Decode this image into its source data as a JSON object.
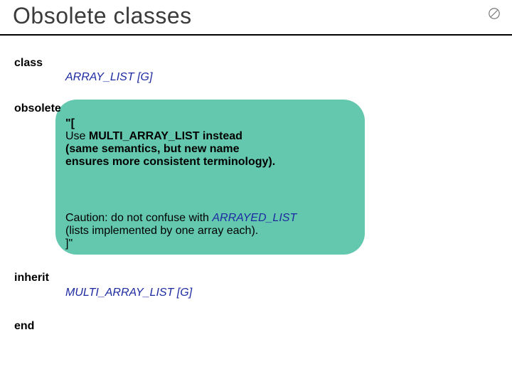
{
  "title": "Obsolete classes",
  "keywords": {
    "class": "class",
    "obsolete": "obsolete",
    "inherit": "inherit",
    "end": "end"
  },
  "class_decl": {
    "name": "ARRAY_LIST",
    "open_bracket": " [",
    "param": "G",
    "close_bracket": "]"
  },
  "obsolete_msg": {
    "open": "\"[",
    "line1_a": "Use ",
    "line1_b": "MULTI_ARRAY_LIST",
    "line1_c": " instead",
    "line2": "(same semantics, but new name",
    "line3": "ensures more consistent terminology).",
    "caution_a": "Caution: do not confuse with ",
    "caution_b": "ARRAYED_LIST",
    "caution_c": "(lists implemented by one array each).",
    "close": "]\""
  },
  "inherit_decl": {
    "name": "MULTI_ARRAY_LIST",
    "open_bracket": " [",
    "param": "G",
    "close_bracket": "]"
  },
  "logo_name": "circle-slash-icon"
}
